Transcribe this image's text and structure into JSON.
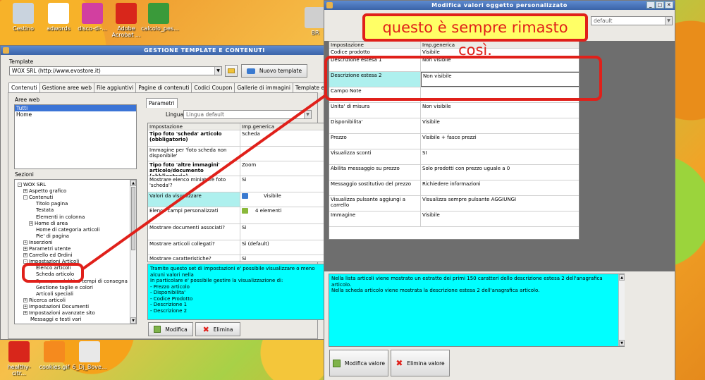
{
  "desktop": {
    "icons": [
      {
        "label": "Cestino",
        "color": "#c9d3de"
      },
      {
        "label": "adwords",
        "color": "#ffffff"
      },
      {
        "label": "disco-di-...",
        "color": "#d23fa0"
      },
      {
        "label": "Adobe Acrobat ...",
        "color": "#d8261b"
      },
      {
        "label": "calcolo_pes...",
        "color": "#3a9a3a"
      },
      {
        "label": "healthy-citr...",
        "color": "#d8261b"
      },
      {
        "label": "cookies.gif",
        "color": "#f58a1e"
      },
      {
        "label": "6_Dj_Bove...",
        "color": "#e8e8e8"
      }
    ],
    "truncated_label": "BR"
  },
  "main_window": {
    "title": "GESTIONE TEMPLATE E CONTENUTI",
    "template_label": "Template",
    "template_value": "WOX SRL (http://www.evostore.it)",
    "new_template_button": "Nuovo template",
    "tabs": [
      "Contenuti",
      "Gestione aree web",
      "File aggiuntivi",
      "Pagine di contenuti",
      "Codici Coupon",
      "Gallerie di immagini",
      "Template e plugins"
    ],
    "aree_web_label": "Aree web",
    "aree_web_items": [
      "Tutti",
      "Home"
    ],
    "sezioni_label": "Sezioni",
    "tree": [
      {
        "label": "WOX SRL",
        "exp": "-",
        "indent": 0
      },
      {
        "label": "Aspetto grafico",
        "exp": "+",
        "indent": 1
      },
      {
        "label": "Contenuti",
        "exp": "-",
        "indent": 1
      },
      {
        "label": "Titolo pagina",
        "exp": "",
        "indent": 2
      },
      {
        "label": "Testata",
        "exp": "",
        "indent": 2
      },
      {
        "label": "Elementi in colonna",
        "exp": "",
        "indent": 2
      },
      {
        "label": "Home di area",
        "exp": "+",
        "indent": 2
      },
      {
        "label": "Home di categoria articoli",
        "exp": "",
        "indent": 2
      },
      {
        "label": "Pie' di pagina",
        "exp": "",
        "indent": 2
      },
      {
        "label": "Inserzioni",
        "exp": "+",
        "indent": 1
      },
      {
        "label": "Parametri utente",
        "exp": "+",
        "indent": 1
      },
      {
        "label": "Carrello ed Ordini",
        "exp": "+",
        "indent": 1
      },
      {
        "label": "Impostazioni Articoli",
        "exp": "-",
        "indent": 1
      },
      {
        "label": "Elenco articoli",
        "exp": "",
        "indent": 2
      },
      {
        "label": "Scheda articolo",
        "exp": "",
        "indent": 2
      },
      {
        "label": "Spese, modalità e tempi di consegna",
        "exp": "",
        "indent": 2
      },
      {
        "label": "Gestione taglie e colori",
        "exp": "",
        "indent": 2
      },
      {
        "label": "Articoli speciali",
        "exp": "",
        "indent": 2
      },
      {
        "label": "Ricerca articoli",
        "exp": "+",
        "indent": 1
      },
      {
        "label": "Impostazioni Documenti",
        "exp": "+",
        "indent": 1
      },
      {
        "label": "Impostazioni avanzate sito",
        "exp": "+",
        "indent": 1
      },
      {
        "label": "Messaggi e testi vari",
        "exp": "",
        "indent": 1
      }
    ],
    "params_tab": "Parametri",
    "lingua_label": "Lingua :",
    "lingua_value": "Lingua default",
    "grid_headers": [
      "Impostazione",
      "Imp.generica"
    ],
    "grid_rows": [
      {
        "name": "Tipo foto 'scheda' articolo (obbligatorio)",
        "value": "Scheda",
        "bold": true,
        "hl": false,
        "h": 23
      },
      {
        "name": "Immagine per 'foto scheda non disponibile'",
        "value": "",
        "bold": false,
        "hl": false,
        "h": 21
      },
      {
        "name": "Tipo foto 'altre immagini' articolo/documento (obbligatorio)",
        "value": "Zoom",
        "bold": true,
        "hl": false,
        "h": 21
      },
      {
        "name": "Mostrare elenco miniature foto 'scheda'?",
        "value": "Si",
        "bold": false,
        "hl": false,
        "h": 23
      },
      {
        "name": "Valori da visualizzare",
        "value": "Visibile",
        "bold": false,
        "hl": true,
        "h": 21
      },
      {
        "name": "Elenco campi personalizzati",
        "value": "4 elementi",
        "bold": false,
        "hl": false,
        "h": 24
      },
      {
        "name": "Mostrare documenti associati?",
        "value": "Si",
        "bold": false,
        "hl": false,
        "h": 23
      },
      {
        "name": "Mostrare articoli collegati?",
        "value": "Sì (default)",
        "bold": false,
        "hl": false,
        "h": 21
      },
      {
        "name": "Mostrare caratteristiche?",
        "value": "Si",
        "bold": false,
        "hl": false,
        "h": 12
      }
    ],
    "description": "Tramite questo set di impostazioni e' possibile visualizzare o meno alcuni valori nella\nIn particolare e' possibile gestire la visualizzazione di:\n- Prezzo articolo\n- Disponibilita'\n- Codice Prodotto\n- Descrizione 1\n- Descrizione 2",
    "modify_button": "Modifica",
    "delete_button": "Elimina"
  },
  "dialog": {
    "title": "Modifica valori oggetto personalizzato",
    "combo_value": "default",
    "grid_headers": [
      "Impostazione",
      "Imp.generica"
    ],
    "grid_rows": [
      {
        "name": "Codice prodotto",
        "value": "Visibile",
        "h": 11,
        "hl": false
      },
      {
        "name": "Descrizione estesa 1",
        "value": "Non visibile",
        "h": 22,
        "hl": false
      },
      {
        "name": "Descrizione estesa 2",
        "value": "Non visibile",
        "h": 22,
        "hl": true
      },
      {
        "name": "Campo Note",
        "value": "",
        "h": 22,
        "hl": false
      },
      {
        "name": "Unita' di misura",
        "value": "Non visibile",
        "h": 22,
        "hl": false
      },
      {
        "name": "Disponibilita'",
        "value": "Visibile",
        "h": 22,
        "hl": false
      },
      {
        "name": "Prezzo",
        "value": "Visibile + fasce prezzi",
        "h": 22,
        "hl": false
      },
      {
        "name": "Visualizza sconti",
        "value": "SI",
        "h": 22,
        "hl": false
      },
      {
        "name": "Abilita messaggio su prezzo",
        "value": "Solo prodotti con prezzo uguale a 0",
        "h": 22,
        "hl": false
      },
      {
        "name": "Messaggio sostitutivo del prezzo",
        "value": "Richiedere informazioni",
        "h": 22,
        "hl": false
      },
      {
        "name": "Visualizza pulsante aggiungi a carrello",
        "value": "Visualizza sempre pulsante AGGIUNGI",
        "h": 22,
        "hl": false
      },
      {
        "name": "Immagine",
        "value": "Visibile",
        "h": 22,
        "hl": false
      }
    ],
    "description": "Nella lista articoli viene mostrato un estratto dei primi 150 caratteri dello descrizione estesa 2 dell'anagrafica articolo.\nNella scheda articolo viene mostrata la descrizione estesa 2 dell'anagrafica articolo.",
    "modify_button": "Modifica valore",
    "delete_button": "Elimina valore"
  },
  "annotation": {
    "callout": "questo è sempre rimasto così."
  }
}
